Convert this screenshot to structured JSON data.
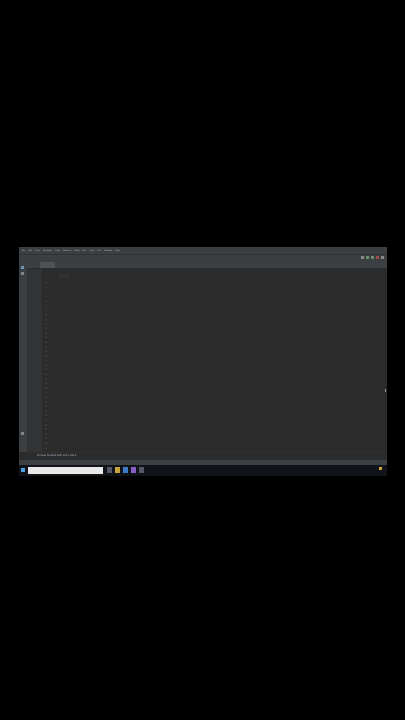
{
  "menubar": {
    "items": [
      "File",
      "Edit",
      "View",
      "Navigate",
      "Code",
      "Refactor",
      "Build",
      "Run",
      "Tools",
      "VCS",
      "Window",
      "Help"
    ]
  },
  "toolbar": {
    "breadcrumb": ""
  },
  "editor_tab": {
    "label": ""
  },
  "editor": {
    "line_numbers": [
      "1",
      "2",
      "3",
      "4",
      "5",
      "6",
      "7",
      "8",
      "9",
      "10",
      "11",
      "12",
      "13",
      "14",
      "15",
      "16",
      "17",
      "18",
      "19",
      "20",
      "21",
      "22",
      "23",
      "24",
      "25",
      "26",
      "27",
      "28",
      "29",
      "30",
      "31",
      "32",
      "33",
      "34",
      "35",
      "36",
      "37",
      "38",
      "39"
    ]
  },
  "console": {
    "text": "Process finished with exit code 0"
  },
  "statusbar": {
    "left": "",
    "right": ""
  },
  "taskbar": {
    "search_placeholder": "Type here to search",
    "tray_time": ""
  }
}
